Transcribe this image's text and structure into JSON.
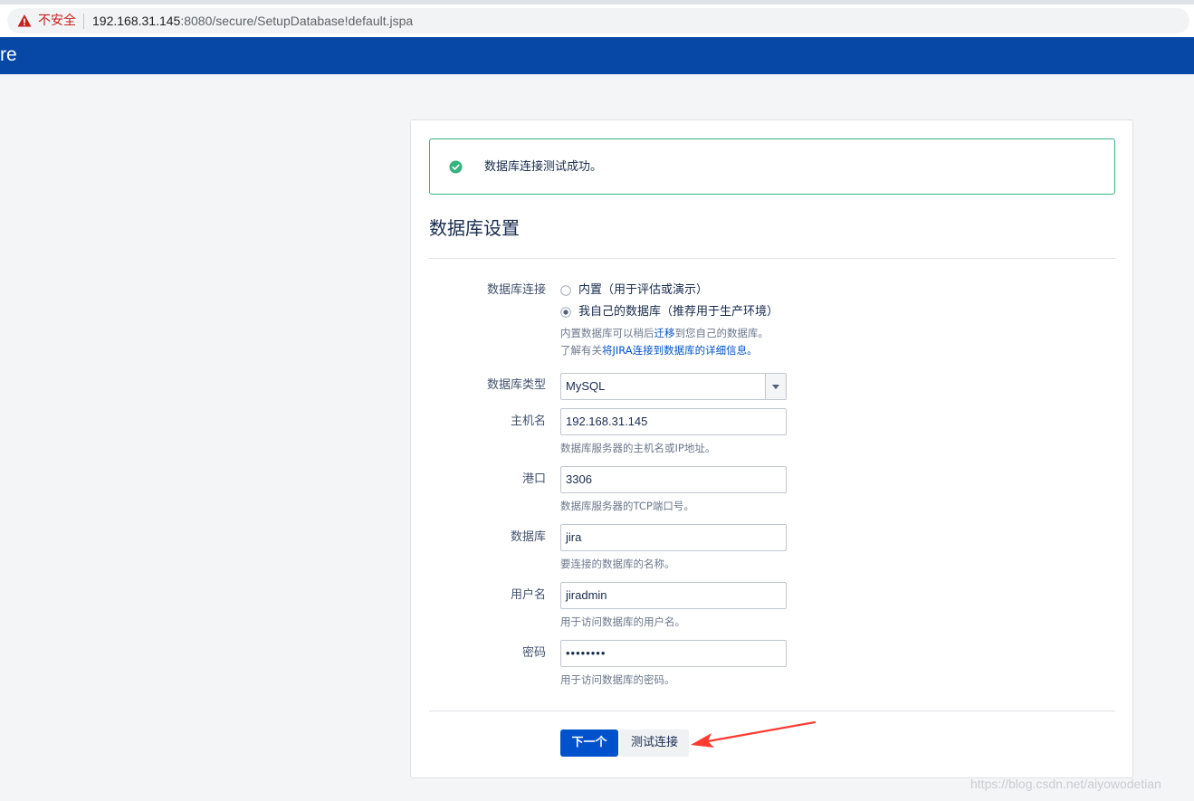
{
  "browser": {
    "security_label": "不安全",
    "url_host": "192.168.31.145",
    "url_path": ":8080/secure/SetupDatabase!default.jspa"
  },
  "header": {
    "brand": "re"
  },
  "message": {
    "text": "数据库连接测试成功。",
    "icon": "check-circle-icon",
    "color": "#36b37e"
  },
  "form": {
    "title": "数据库设置",
    "connection": {
      "label": "数据库连接",
      "options": [
        {
          "label": "内置（用于评估或演示）",
          "selected": false
        },
        {
          "label": "我自己的数据库（推荐用于生产环境）",
          "selected": true
        }
      ],
      "desc_prefix": "内置数据库可以稍后",
      "desc_link": "迁移",
      "desc_suffix": "到您自己的数据库。",
      "learn_prefix": "了解有关",
      "learn_link": "将JIRA连接到数据库的详细信息。"
    },
    "db_type": {
      "label": "数据库类型",
      "value": "MySQL"
    },
    "host": {
      "label": "主机名",
      "value": "192.168.31.145",
      "desc": "数据库服务器的主机名或IP地址。"
    },
    "port": {
      "label": "港口",
      "value": "3306",
      "desc": "数据库服务器的TCP端口号。"
    },
    "database": {
      "label": "数据库",
      "value": "jira",
      "desc": "要连接的数据库的名称。"
    },
    "username": {
      "label": "用户名",
      "value": "jiradmin",
      "desc": "用于访问数据库的用户名。"
    },
    "password": {
      "label": "密码",
      "value": "••••••••",
      "desc": "用于访问数据库的密码。"
    }
  },
  "buttons": {
    "next": "下一个",
    "test": "测试连接"
  },
  "watermark": "https://blog.csdn.net/aiyowodetian",
  "colors": {
    "header": "#0747a6",
    "primary": "#0052cc",
    "success": "#36b37e",
    "annotation_arrow": "#ff3b30"
  }
}
